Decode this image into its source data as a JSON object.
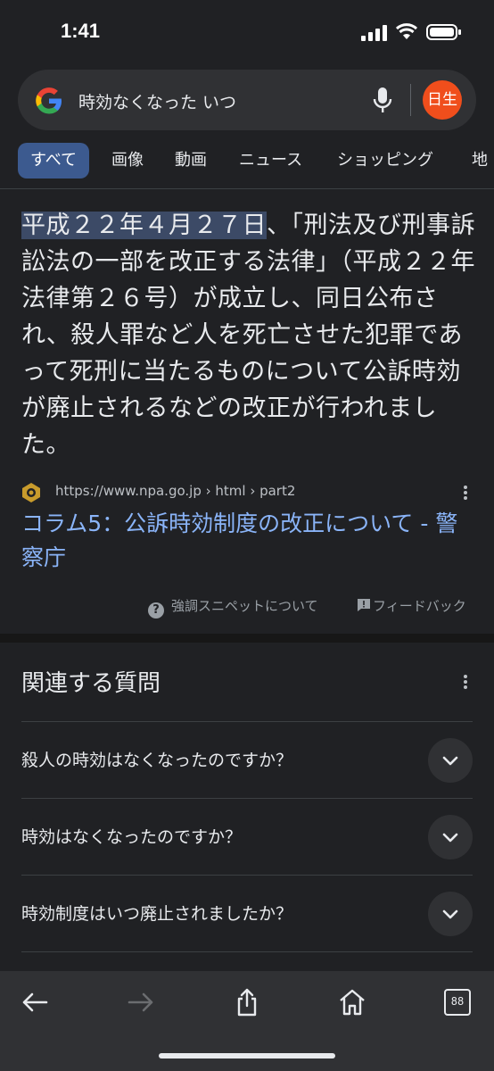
{
  "status": {
    "time": "1:41"
  },
  "search": {
    "query": "時効なくなった いつ",
    "avatar_label": "日生"
  },
  "tabs": [
    "すべて",
    "画像",
    "動画",
    "ニュース",
    "ショッピング",
    "地"
  ],
  "snippet": {
    "highlight": "平成２２年４月２７日",
    "body": "、「刑法及び刑事訴訟法の一部を改正する法律」（平成２２年法律第２６号）が成立し、同日公布され、殺人罪など人を死亡させた犯罪であって死刑に当たるものについて公訴時効が廃止されるなどの改正が行われました。"
  },
  "source": {
    "url": "https://www.npa.go.jp › html › part2",
    "title": "コラム5：公訴時効制度の改正について - 警察庁"
  },
  "actions": {
    "about": "強調スニペットについて",
    "feedback": "フィードバック"
  },
  "paa": {
    "title": "関連する質問",
    "questions": [
      "殺人の時効はなくなったのですか？",
      "時効はなくなったのですか？",
      "時効制度はいつ廃止されましたか？"
    ]
  },
  "bottom_nav": {
    "tabs_count": "88"
  }
}
